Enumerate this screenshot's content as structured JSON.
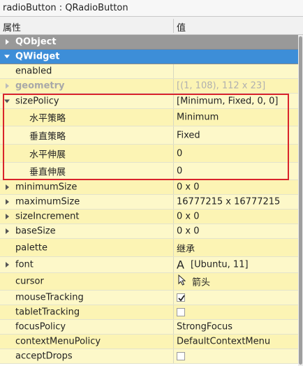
{
  "window": {
    "title": "radioButton : QRadioButton"
  },
  "header": {
    "property_col": "属性",
    "value_col": "值"
  },
  "groups": {
    "qobject": "QObject",
    "qwidget": "QWidget"
  },
  "props": {
    "enabled": {
      "name": "enabled",
      "value": ""
    },
    "geometry": {
      "name": "geometry",
      "value": "[(1, 108), 112 x 23]"
    },
    "sizePolicy": {
      "name": "sizePolicy",
      "value": "[Minimum, Fixed, 0, 0]"
    },
    "hPolicy": {
      "name": "水平策略",
      "value": "Minimum"
    },
    "vPolicy": {
      "name": "垂直策略",
      "value": "Fixed"
    },
    "hStretch": {
      "name": "水平伸展",
      "value": "0"
    },
    "vStretch": {
      "name": "垂直伸展",
      "value": "0"
    },
    "minimumSize": {
      "name": "minimumSize",
      "value": "0 x 0"
    },
    "maximumSize": {
      "name": "maximumSize",
      "value": "16777215 x 16777215"
    },
    "sizeIncrement": {
      "name": "sizeIncrement",
      "value": "0 x 0"
    },
    "baseSize": {
      "name": "baseSize",
      "value": "0 x 0"
    },
    "palette": {
      "name": "palette",
      "value": "继承"
    },
    "font": {
      "name": "font",
      "icon": "A",
      "value": "[Ubuntu, 11]"
    },
    "cursor": {
      "name": "cursor",
      "icon": "arrow-cursor-icon",
      "value": "箭头"
    },
    "mouseTracking": {
      "name": "mouseTracking",
      "checked": true
    },
    "tabletTracking": {
      "name": "tabletTracking",
      "checked": false
    },
    "focusPolicy": {
      "name": "focusPolicy",
      "value": "StrongFocus"
    },
    "contextMenuPolicy": {
      "name": "contextMenuPolicy",
      "value": "DefaultContextMenu"
    },
    "acceptDrops": {
      "name": "acceptDrops",
      "checked": false
    }
  },
  "colors": {
    "highlight_box": "#d9232a",
    "active_group": "#3d8ed8",
    "group": "#999999"
  }
}
